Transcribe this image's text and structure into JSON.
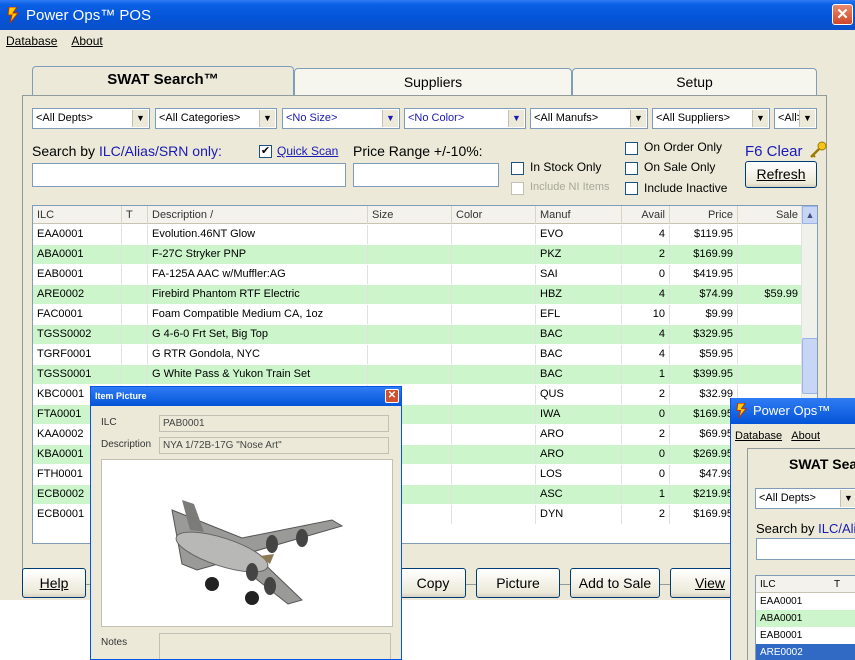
{
  "window": {
    "title": "Power Ops™ POS",
    "close": "✕"
  },
  "menu": {
    "database": "Database",
    "about": "About"
  },
  "tabs": [
    "SWAT Search™",
    "Suppliers",
    "Setup"
  ],
  "filters": {
    "depts": "<All Depts>",
    "categories": "<All Categories>",
    "size": "<No Size>",
    "color": "<No Color>",
    "manufs": "<All Manufs>",
    "suppliers": "<All Suppliers>",
    "all": "<All>"
  },
  "search": {
    "label_prefix": "Search by ",
    "label_highlight": "ILC/Alias/SRN only:",
    "quick_scan_label": "Quick Scan",
    "quick_scan_checked": "✔",
    "price_range_label": "Price Range +/-10%:",
    "value": "",
    "price_value": ""
  },
  "options": {
    "in_stock_only": "In Stock Only",
    "include_ni_items": "Include NI Items",
    "on_order_only": "On Order Only",
    "on_sale_only": "On Sale Only",
    "include_inactive": "Include Inactive"
  },
  "f6_clear": "F6 Clear",
  "refresh": "Refresh",
  "grid": {
    "columns": [
      "ILC",
      "T",
      "Description /",
      "Size",
      "Color",
      "Manuf",
      "Avail",
      "Price",
      "Sale"
    ],
    "rows": [
      [
        "EAA0001",
        "",
        "Evolution.46NT Glow",
        "",
        "",
        "EVO",
        "4",
        "$119.95",
        ""
      ],
      [
        "ABA0001",
        "",
        "F-27C Stryker PNP",
        "",
        "",
        "PKZ",
        "2",
        "$169.99",
        ""
      ],
      [
        "EAB0001",
        "",
        "FA-125A AAC w/Muffler:AG",
        "",
        "",
        "SAI",
        "0",
        "$419.95",
        ""
      ],
      [
        "ARE0002",
        "",
        "Firebird Phantom RTF Electric",
        "",
        "",
        "HBZ",
        "4",
        "$74.99",
        "$59.99"
      ],
      [
        "FAC0001",
        "",
        "Foam Compatible Medium CA, 1oz",
        "",
        "",
        "EFL",
        "10",
        "$9.99",
        ""
      ],
      [
        "TGSS0002",
        "",
        "G 4-6-0 Frt Set, Big Top",
        "",
        "",
        "BAC",
        "4",
        "$329.95",
        ""
      ],
      [
        "TGRF0001",
        "",
        "G RTR Gondola, NYC",
        "",
        "",
        "BAC",
        "4",
        "$59.95",
        ""
      ],
      [
        "TGSS0001",
        "",
        "G White Pass & Yukon Train Set",
        "",
        "",
        "BAC",
        "1",
        "$399.95",
        ""
      ],
      [
        "KBC0001",
        "",
        "",
        "",
        "",
        "QUS",
        "2",
        "$32.99",
        ""
      ],
      [
        "FTA0001",
        "",
        "",
        "",
        "",
        "IWA",
        "0",
        "$169.95",
        ""
      ],
      [
        "KAA0002",
        "",
        "",
        "",
        "",
        "ARO",
        "2",
        "$69.95",
        ""
      ],
      [
        "KBA0001",
        "",
        "",
        "",
        "",
        "ARO",
        "0",
        "$269.95",
        ""
      ],
      [
        "FTH0001",
        "",
        "",
        "",
        "",
        "LOS",
        "0",
        "$47.99",
        ""
      ],
      [
        "ECB0002",
        "",
        "",
        "",
        "",
        "ASC",
        "1",
        "$219.95",
        ""
      ],
      [
        "ECB0001",
        "",
        "",
        "",
        "",
        "DYN",
        "2",
        "$169.95",
        ""
      ]
    ]
  },
  "buttons": {
    "help": "Help",
    "copy": "Copy",
    "picture": "Picture",
    "add_to_sale": "Add to Sale",
    "view": "View"
  },
  "item_picture": {
    "title": "Item Picture",
    "ilc_label": "ILC",
    "ilc_value": "PAB0001",
    "desc_label": "Description",
    "desc_value": "NYA 1/72B-17G \"Nose Art\"",
    "notes_label": "Notes"
  },
  "second_window": {
    "title": "Power Ops™",
    "menu_database": "Database",
    "menu_about": "About",
    "tab": "SWAT Sear",
    "depts": "<All Depts>",
    "search_prefix": "Search by ",
    "search_highlight": "ILC/Ali",
    "col_ilc": "ILC",
    "col_t": "T",
    "rows": [
      "EAA0001",
      "ABA0001",
      "EAB0001",
      "ARE0002"
    ]
  }
}
